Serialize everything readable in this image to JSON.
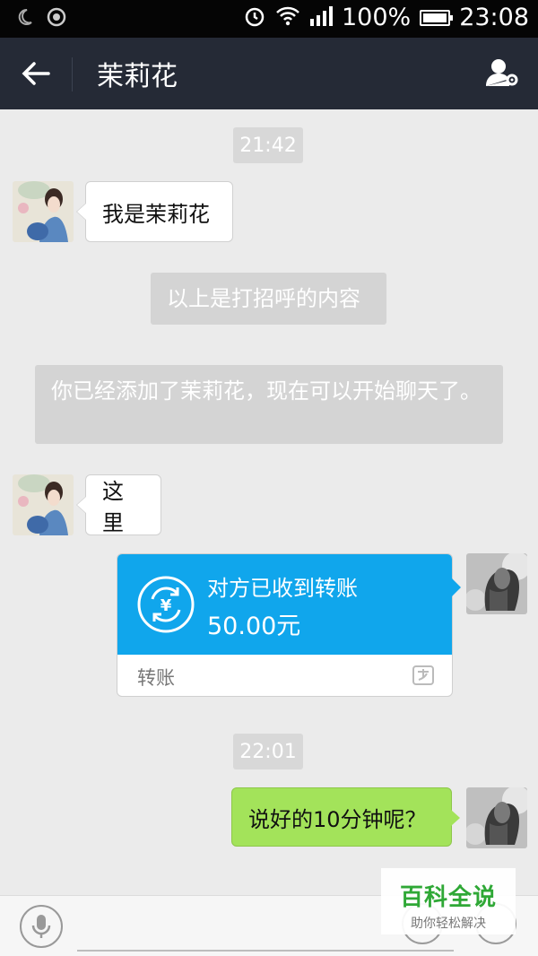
{
  "status_bar": {
    "battery": "100%",
    "time": "23:08"
  },
  "header": {
    "title": "茉莉花"
  },
  "messages": {
    "time1": "21:42",
    "msg1": "我是茉莉花",
    "sys1": "以上是打招呼的内容",
    "sys2": "你已经添加了茉莉花，现在可以开始聊天了。",
    "msg2": "这里",
    "transfer_title": "对方已收到转账",
    "transfer_amount": "50.00元",
    "transfer_footer": "转账",
    "time2": "22:01",
    "msg3": "说好的10分钟呢？"
  },
  "watermark": {
    "main": "百科全说",
    "sub": "助你轻松解决"
  },
  "colors": {
    "header_bg": "#252a36",
    "transfer_blue": "#10a6ec",
    "sent_bubble_green": "#a3e35a",
    "chat_bg": "#ebebeb"
  }
}
